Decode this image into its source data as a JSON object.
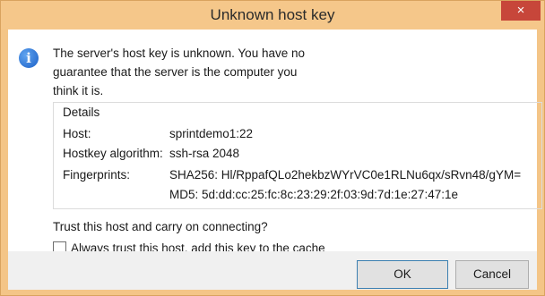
{
  "window": {
    "title": "Unknown host key",
    "close_glyph": "×"
  },
  "icons": {
    "info": "info-icon",
    "close": "close-icon"
  },
  "message": "The server's host key is unknown. You have no guarantee that the server is the computer you think it is.",
  "details": {
    "legend": "Details",
    "host_label": "Host:",
    "host_value": "sprintdemo1:22",
    "algorithm_label": "Hostkey algorithm:",
    "algorithm_value": "ssh-rsa 2048",
    "fingerprints_label": "Fingerprints:",
    "fingerprint_sha256": "SHA256: Hl/RppafQLo2hekbzWYrVC0e1RLNu6qx/sRvn48/gYM=",
    "fingerprint_md5": "MD5: 5d:dd:cc:25:fc:8c:23:29:2f:03:9d:7d:1e:27:47:1e"
  },
  "trust_question": "Trust this host and carry on connecting?",
  "always_trust": {
    "label": "Always trust this host, add this key to the cache",
    "checked": false
  },
  "buttons": {
    "ok": "OK",
    "cancel": "Cancel"
  },
  "colors": {
    "titlebar": "#f5c78a",
    "close_button": "#c7463a",
    "info_icon": "#1b5fc6"
  }
}
